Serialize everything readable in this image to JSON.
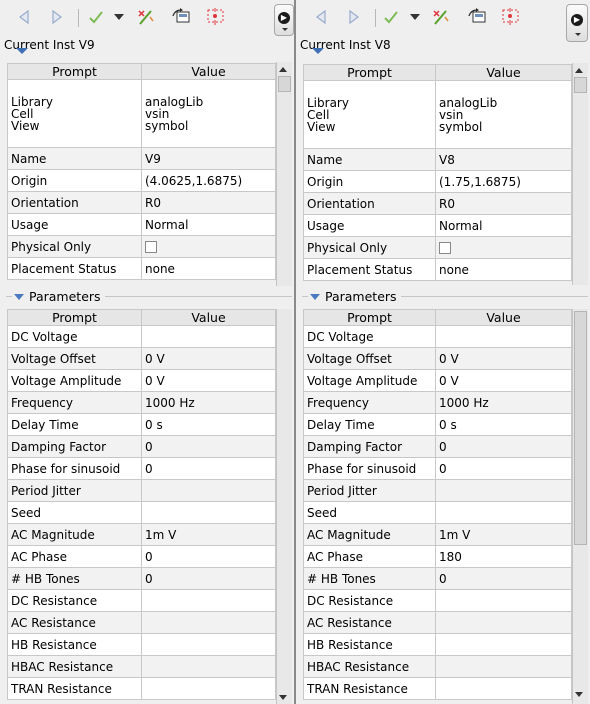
{
  "panels": [
    {
      "title": "Current Inst V9",
      "prompt_header": "Prompt",
      "value_header": "Value",
      "lib_cell_view": {
        "prompts": [
          "Library",
          "Cell",
          "View"
        ],
        "values": [
          "analogLib",
          "vsin",
          "symbol"
        ]
      },
      "properties": [
        {
          "prompt": "Name",
          "value": "V9"
        },
        {
          "prompt": "Origin",
          "value": "(4.0625,1.6875)"
        },
        {
          "prompt": "Orientation",
          "value": "R0"
        },
        {
          "prompt": "Usage",
          "value": "Normal"
        },
        {
          "prompt": "Physical Only",
          "value": "",
          "checkbox": true
        },
        {
          "prompt": "Placement Status",
          "value": "none"
        }
      ],
      "parameters_label": "Parameters",
      "parameters": [
        {
          "prompt": "DC Voltage",
          "value": ""
        },
        {
          "prompt": "Voltage Offset",
          "value": "0 V"
        },
        {
          "prompt": "Voltage Amplitude",
          "value": "0 V"
        },
        {
          "prompt": "Frequency",
          "value": "1000 Hz"
        },
        {
          "prompt": "Delay Time",
          "value": "0 s"
        },
        {
          "prompt": "Damping Factor",
          "value": "0"
        },
        {
          "prompt": "Phase for sinusoid",
          "value": "0"
        },
        {
          "prompt": "Period Jitter",
          "value": ""
        },
        {
          "prompt": "Seed",
          "value": ""
        },
        {
          "prompt": "AC Magnitude",
          "value": "1m V"
        },
        {
          "prompt": "AC Phase",
          "value": "0"
        },
        {
          "prompt": "# HB Tones",
          "value": "0"
        },
        {
          "prompt": "DC Resistance",
          "value": ""
        },
        {
          "prompt": "AC Resistance",
          "value": ""
        },
        {
          "prompt": "HB Resistance",
          "value": ""
        },
        {
          "prompt": "HBAC Resistance",
          "value": ""
        },
        {
          "prompt": "TRAN Resistance",
          "value": ""
        }
      ]
    },
    {
      "title": "Current Inst V8",
      "prompt_header": "Prompt",
      "value_header": "Value",
      "lib_cell_view": {
        "prompts": [
          "Library",
          "Cell",
          "View"
        ],
        "values": [
          "analogLib",
          "vsin",
          "symbol"
        ]
      },
      "properties": [
        {
          "prompt": "Name",
          "value": "V8"
        },
        {
          "prompt": "Origin",
          "value": "(1.75,1.6875)"
        },
        {
          "prompt": "Orientation",
          "value": "R0"
        },
        {
          "prompt": "Usage",
          "value": "Normal"
        },
        {
          "prompt": "Physical Only",
          "value": "",
          "checkbox": true
        },
        {
          "prompt": "Placement Status",
          "value": "none"
        }
      ],
      "parameters_label": "Parameters",
      "parameters": [
        {
          "prompt": "DC Voltage",
          "value": ""
        },
        {
          "prompt": "Voltage Offset",
          "value": "0 V"
        },
        {
          "prompt": "Voltage Amplitude",
          "value": "0 V"
        },
        {
          "prompt": "Frequency",
          "value": "1000 Hz"
        },
        {
          "prompt": "Delay Time",
          "value": "0 s"
        },
        {
          "prompt": "Damping Factor",
          "value": "0"
        },
        {
          "prompt": "Phase for sinusoid",
          "value": "0"
        },
        {
          "prompt": "Period Jitter",
          "value": ""
        },
        {
          "prompt": "Seed",
          "value": ""
        },
        {
          "prompt": "AC Magnitude",
          "value": "1m V"
        },
        {
          "prompt": "AC Phase",
          "value": "180"
        },
        {
          "prompt": "# HB Tones",
          "value": "0"
        },
        {
          "prompt": "DC Resistance",
          "value": ""
        },
        {
          "prompt": "AC Resistance",
          "value": ""
        },
        {
          "prompt": "HB Resistance",
          "value": ""
        },
        {
          "prompt": "HBAC Resistance",
          "value": ""
        },
        {
          "prompt": "TRAN Resistance",
          "value": ""
        }
      ]
    }
  ],
  "toolbar_icons": [
    "back-arrow-icon",
    "forward-arrow-icon",
    "checkmark-icon",
    "dropdown-arrow-icon",
    "edit-wand-icon",
    "copy-properties-icon",
    "select-area-icon",
    "more-options-icon"
  ],
  "colors": {
    "icon_blue": "#6f8fbf",
    "check_green": "#5aa02c",
    "wand_orange": "#e08a3c",
    "select_red": "#e0343c",
    "header_bg": "#e6e6e6",
    "triangle_blue": "#4a79c2"
  }
}
